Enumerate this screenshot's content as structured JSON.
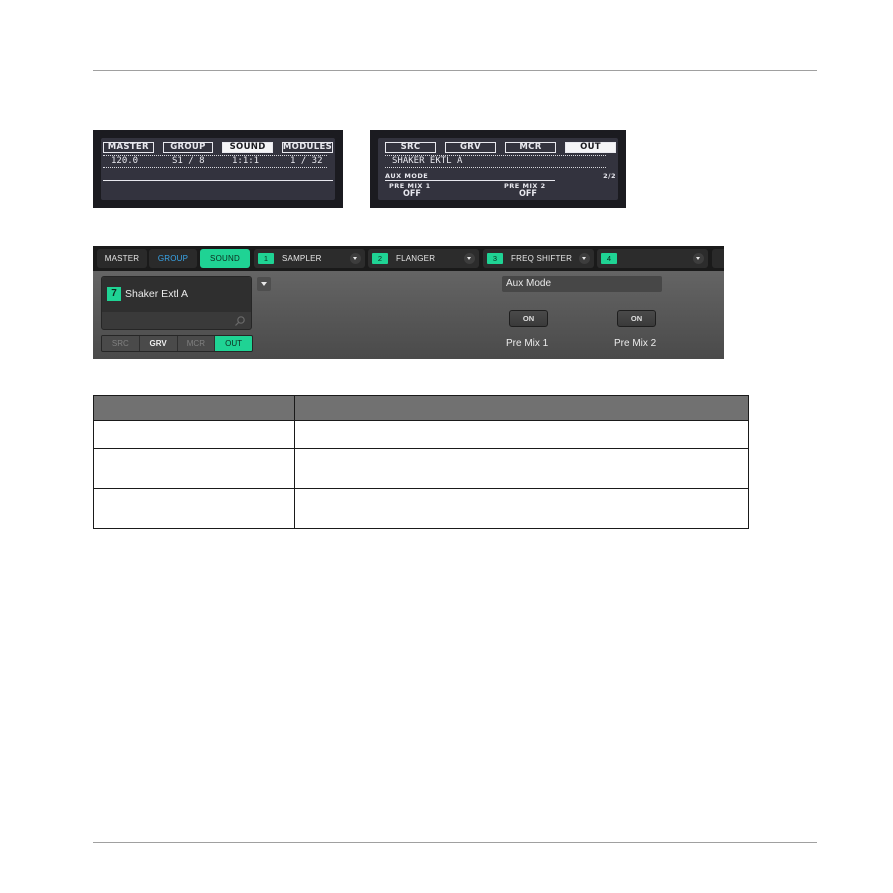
{
  "hardware_display_left": {
    "tabs": [
      "MASTER",
      "GROUP",
      "SOUND",
      "MODULES"
    ],
    "active_tab": "SOUND",
    "values": [
      "120.0",
      "S1 / 8",
      "1:1:1",
      "1 / 32"
    ]
  },
  "hardware_display_right": {
    "tabs": [
      "SRC",
      "GRV",
      "MCR",
      "OUT"
    ],
    "active_tab": "OUT",
    "sound_name": "SHAKER EKTL A",
    "section_label": "AUX MODE",
    "page_indicator": "2/2",
    "params": [
      {
        "label": "PRE MIX 1",
        "value": "OFF"
      },
      {
        "label": "PRE MIX 2",
        "value": "OFF"
      }
    ]
  },
  "software_ui": {
    "tabs": {
      "master": "MASTER",
      "group": "GROUP",
      "sound": "SOUND"
    },
    "slots": [
      {
        "number": "1",
        "name": "SAMPLER"
      },
      {
        "number": "2",
        "name": "FLANGER"
      },
      {
        "number": "3",
        "name": "FREQ SHIFTER"
      },
      {
        "number": "4",
        "name": ""
      }
    ],
    "preset": {
      "number": "7",
      "name": "Shaker Extl A"
    },
    "page_tabs": [
      "SRC",
      "GRV",
      "MCR",
      "OUT"
    ],
    "active_page_tab": "OUT",
    "section_header": "Aux Mode",
    "params": [
      {
        "label": "Pre Mix 1",
        "button": "ON"
      },
      {
        "label": "Pre Mix 2",
        "button": "ON"
      }
    ]
  },
  "table": {
    "headers": [
      "",
      ""
    ],
    "rows": [
      [
        "",
        ""
      ],
      [
        "",
        ""
      ],
      [
        "",
        ""
      ]
    ]
  },
  "colors": {
    "accent_green": "#1fd394",
    "group_blue": "#39a6ea"
  }
}
